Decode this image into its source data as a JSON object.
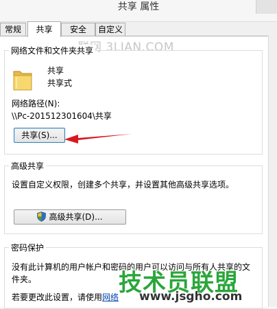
{
  "window": {
    "title": "共享 属性"
  },
  "tabs": [
    {
      "label": "常规"
    },
    {
      "label": "共享"
    },
    {
      "label": "安全"
    },
    {
      "label": "自定义"
    }
  ],
  "watermark_top": "一联网 3LIAN.COM",
  "network_sharing": {
    "group_title": "网络文件和文件夹共享",
    "folder_name": "共享",
    "share_status": "共享式",
    "path_label": "网络路径(N):",
    "path_value": "\\\\Pc-201512301604\\共享",
    "share_button": "共享(S)..."
  },
  "advanced_sharing": {
    "group_title": "高级共享",
    "description": "设置自定义权限，创建多个共享，并设置其他高级共享选项。",
    "button": "高级共享(D)..."
  },
  "password_protection": {
    "group_title": "密码保护",
    "line1": "没有此计算机的用户帐户和密码的用户可以访问与所有人共享的文",
    "line2": "件夹。",
    "line3_prefix": "若要更改此设置，请使用",
    "line3_link": "网络"
  },
  "watermark_logo": {
    "name": "技术员联盟",
    "url": "www.jsgho.com"
  },
  "colors": {
    "arrow": "#d7191e",
    "logo_green": "#2aa63a",
    "link": "#0645ad"
  }
}
